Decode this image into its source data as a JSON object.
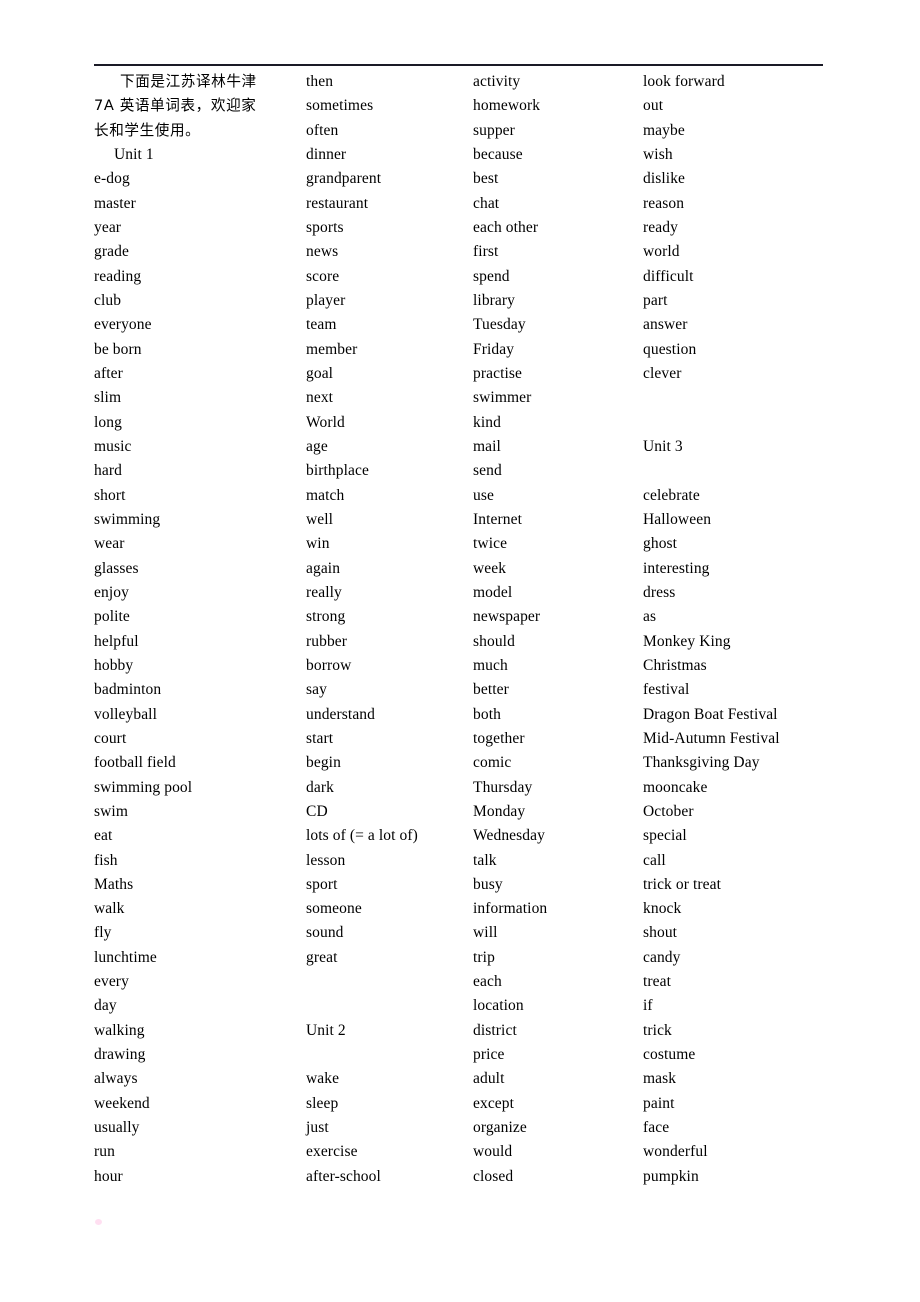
{
  "document": {
    "title": "7A 英语单词表",
    "rule_color": "#1a1a26",
    "background_color": "#ffffff",
    "text_color": "#000000"
  },
  "intro": {
    "line1": "下面是江苏译林牛津",
    "line2": "7A 英语单词表，欢迎家",
    "line3": "长和学生使用。"
  },
  "headings": {
    "unit1": "Unit 1",
    "unit2": "Unit 2",
    "unit3": "Unit 3"
  },
  "columns": [
    {
      "id": "column-1",
      "entries": [
        {
          "text": "下面是江苏译林牛津",
          "style": "cn indent"
        },
        {
          "text": "7A 英语单词表，欢迎家",
          "style": "cn"
        },
        {
          "text": "长和学生使用。",
          "style": "cn"
        },
        {
          "text": "Unit 1",
          "style": "unit indent-sm"
        },
        {
          "text": "e-dog",
          "style": ""
        },
        {
          "text": "master",
          "style": ""
        },
        {
          "text": "year",
          "style": ""
        },
        {
          "text": "grade",
          "style": ""
        },
        {
          "text": "reading",
          "style": ""
        },
        {
          "text": "club",
          "style": ""
        },
        {
          "text": "everyone",
          "style": ""
        },
        {
          "text": "be born",
          "style": ""
        },
        {
          "text": "after",
          "style": ""
        },
        {
          "text": "slim",
          "style": ""
        },
        {
          "text": "long",
          "style": ""
        },
        {
          "text": "music",
          "style": ""
        },
        {
          "text": "hard",
          "style": ""
        },
        {
          "text": "short",
          "style": ""
        },
        {
          "text": "swimming",
          "style": ""
        },
        {
          "text": "wear",
          "style": ""
        },
        {
          "text": "glasses",
          "style": ""
        },
        {
          "text": "enjoy",
          "style": ""
        },
        {
          "text": "polite",
          "style": ""
        },
        {
          "text": "helpful",
          "style": ""
        },
        {
          "text": "hobby",
          "style": ""
        },
        {
          "text": "badminton",
          "style": ""
        },
        {
          "text": "volleyball",
          "style": ""
        },
        {
          "text": "court",
          "style": ""
        },
        {
          "text": "football field",
          "style": ""
        },
        {
          "text": "swimming pool",
          "style": ""
        },
        {
          "text": "swim",
          "style": ""
        },
        {
          "text": "eat",
          "style": ""
        },
        {
          "text": "fish",
          "style": ""
        },
        {
          "text": "Maths",
          "style": ""
        },
        {
          "text": "walk",
          "style": ""
        },
        {
          "text": "fly",
          "style": ""
        },
        {
          "text": "lunchtime",
          "style": ""
        },
        {
          "text": "every",
          "style": ""
        },
        {
          "text": "day",
          "style": ""
        },
        {
          "text": "walking",
          "style": ""
        },
        {
          "text": "drawing",
          "style": ""
        },
        {
          "text": "always",
          "style": ""
        },
        {
          "text": "weekend",
          "style": ""
        },
        {
          "text": "usually",
          "style": ""
        },
        {
          "text": "run",
          "style": ""
        },
        {
          "text": "hour",
          "style": ""
        }
      ]
    },
    {
      "id": "column-2",
      "entries": [
        {
          "text": "then",
          "style": ""
        },
        {
          "text": "sometimes",
          "style": ""
        },
        {
          "text": "often",
          "style": ""
        },
        {
          "text": "dinner",
          "style": ""
        },
        {
          "text": "grandparent",
          "style": ""
        },
        {
          "text": "restaurant",
          "style": ""
        },
        {
          "text": "sports",
          "style": ""
        },
        {
          "text": "news",
          "style": ""
        },
        {
          "text": "score",
          "style": ""
        },
        {
          "text": "player",
          "style": ""
        },
        {
          "text": "team",
          "style": ""
        },
        {
          "text": "member",
          "style": ""
        },
        {
          "text": "goal",
          "style": ""
        },
        {
          "text": "next",
          "style": ""
        },
        {
          "text": "World",
          "style": ""
        },
        {
          "text": "age",
          "style": ""
        },
        {
          "text": "birthplace",
          "style": ""
        },
        {
          "text": "match",
          "style": ""
        },
        {
          "text": "well",
          "style": ""
        },
        {
          "text": "win",
          "style": ""
        },
        {
          "text": "again",
          "style": ""
        },
        {
          "text": "really",
          "style": ""
        },
        {
          "text": "strong",
          "style": ""
        },
        {
          "text": "rubber",
          "style": ""
        },
        {
          "text": "borrow",
          "style": ""
        },
        {
          "text": "say",
          "style": ""
        },
        {
          "text": "understand",
          "style": ""
        },
        {
          "text": "start",
          "style": ""
        },
        {
          "text": "begin",
          "style": ""
        },
        {
          "text": "dark",
          "style": ""
        },
        {
          "text": "CD",
          "style": ""
        },
        {
          "text": "lots of (= a lot of)",
          "style": ""
        },
        {
          "text": "lesson",
          "style": ""
        },
        {
          "text": "sport",
          "style": ""
        },
        {
          "text": "someone",
          "style": ""
        },
        {
          "text": "sound",
          "style": ""
        },
        {
          "text": "great",
          "style": ""
        },
        {
          "text": "",
          "style": "blank"
        },
        {
          "text": "",
          "style": "blank"
        },
        {
          "text": "Unit 2",
          "style": "unit"
        },
        {
          "text": "",
          "style": "blank"
        },
        {
          "text": "wake",
          "style": ""
        },
        {
          "text": "sleep",
          "style": ""
        },
        {
          "text": "just",
          "style": ""
        },
        {
          "text": "exercise",
          "style": ""
        },
        {
          "text": "after-school",
          "style": ""
        }
      ]
    },
    {
      "id": "column-3",
      "entries": [
        {
          "text": "activity",
          "style": ""
        },
        {
          "text": "homework",
          "style": ""
        },
        {
          "text": "supper",
          "style": ""
        },
        {
          "text": "because",
          "style": ""
        },
        {
          "text": "best",
          "style": ""
        },
        {
          "text": "chat",
          "style": ""
        },
        {
          "text": "each other",
          "style": ""
        },
        {
          "text": "first",
          "style": ""
        },
        {
          "text": "spend",
          "style": ""
        },
        {
          "text": "library",
          "style": ""
        },
        {
          "text": "Tuesday",
          "style": ""
        },
        {
          "text": "Friday",
          "style": ""
        },
        {
          "text": "practise",
          "style": ""
        },
        {
          "text": "swimmer",
          "style": ""
        },
        {
          "text": "kind",
          "style": ""
        },
        {
          "text": "mail",
          "style": ""
        },
        {
          "text": "send",
          "style": ""
        },
        {
          "text": "use",
          "style": ""
        },
        {
          "text": "Internet",
          "style": ""
        },
        {
          "text": "twice",
          "style": ""
        },
        {
          "text": "week",
          "style": ""
        },
        {
          "text": "model",
          "style": ""
        },
        {
          "text": "newspaper",
          "style": ""
        },
        {
          "text": "should",
          "style": ""
        },
        {
          "text": "much",
          "style": ""
        },
        {
          "text": "better",
          "style": ""
        },
        {
          "text": "both",
          "style": ""
        },
        {
          "text": "together",
          "style": ""
        },
        {
          "text": "comic",
          "style": ""
        },
        {
          "text": "Thursday",
          "style": ""
        },
        {
          "text": "Monday",
          "style": ""
        },
        {
          "text": "Wednesday",
          "style": ""
        },
        {
          "text": "talk",
          "style": ""
        },
        {
          "text": "busy",
          "style": ""
        },
        {
          "text": "information",
          "style": ""
        },
        {
          "text": "will",
          "style": ""
        },
        {
          "text": "trip",
          "style": ""
        },
        {
          "text": "each",
          "style": ""
        },
        {
          "text": "location",
          "style": ""
        },
        {
          "text": "district",
          "style": ""
        },
        {
          "text": "price",
          "style": ""
        },
        {
          "text": "adult",
          "style": ""
        },
        {
          "text": "except",
          "style": ""
        },
        {
          "text": "organize",
          "style": ""
        },
        {
          "text": "would",
          "style": ""
        },
        {
          "text": "closed",
          "style": ""
        }
      ]
    },
    {
      "id": "column-4",
      "entries": [
        {
          "text": "look forward",
          "style": ""
        },
        {
          "text": "out",
          "style": ""
        },
        {
          "text": "maybe",
          "style": ""
        },
        {
          "text": "wish",
          "style": ""
        },
        {
          "text": "dislike",
          "style": ""
        },
        {
          "text": "reason",
          "style": ""
        },
        {
          "text": "ready",
          "style": ""
        },
        {
          "text": "world",
          "style": ""
        },
        {
          "text": "difficult",
          "style": ""
        },
        {
          "text": "part",
          "style": ""
        },
        {
          "text": "answer",
          "style": ""
        },
        {
          "text": "question",
          "style": ""
        },
        {
          "text": "clever",
          "style": ""
        },
        {
          "text": "",
          "style": "blank"
        },
        {
          "text": "",
          "style": "blank"
        },
        {
          "text": "Unit 3",
          "style": "unit"
        },
        {
          "text": "",
          "style": "blank"
        },
        {
          "text": "celebrate",
          "style": ""
        },
        {
          "text": "Halloween",
          "style": ""
        },
        {
          "text": "ghost",
          "style": ""
        },
        {
          "text": "interesting",
          "style": ""
        },
        {
          "text": "dress",
          "style": ""
        },
        {
          "text": "as",
          "style": ""
        },
        {
          "text": "Monkey King",
          "style": ""
        },
        {
          "text": "Christmas",
          "style": ""
        },
        {
          "text": "festival",
          "style": ""
        },
        {
          "text": "Dragon Boat Festival",
          "style": ""
        },
        {
          "text": "Mid-Autumn Festival",
          "style": ""
        },
        {
          "text": "Thanksgiving Day",
          "style": ""
        },
        {
          "text": "mooncake",
          "style": ""
        },
        {
          "text": "October",
          "style": ""
        },
        {
          "text": "special",
          "style": ""
        },
        {
          "text": "call",
          "style": ""
        },
        {
          "text": "trick or treat",
          "style": ""
        },
        {
          "text": "knock",
          "style": ""
        },
        {
          "text": "shout",
          "style": ""
        },
        {
          "text": "candy",
          "style": ""
        },
        {
          "text": "treat",
          "style": ""
        },
        {
          "text": "if",
          "style": ""
        },
        {
          "text": "trick",
          "style": ""
        },
        {
          "text": "costume",
          "style": ""
        },
        {
          "text": "mask",
          "style": ""
        },
        {
          "text": "paint",
          "style": ""
        },
        {
          "text": "face",
          "style": ""
        },
        {
          "text": "wonderful",
          "style": ""
        },
        {
          "text": "pumpkin",
          "style": ""
        }
      ]
    }
  ]
}
